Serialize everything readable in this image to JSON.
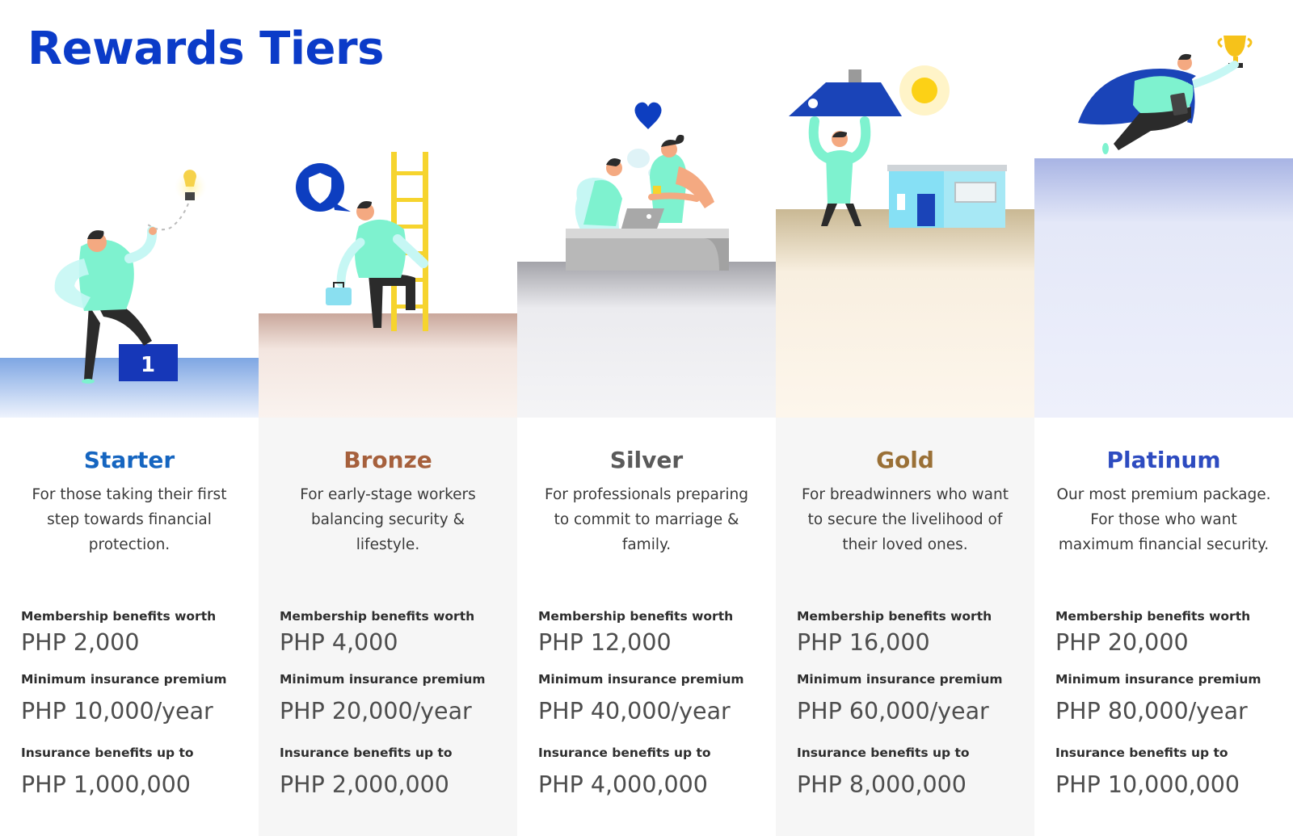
{
  "page": {
    "title": "Rewards Tiers"
  },
  "labels": {
    "membership": "Membership benefits worth",
    "premium": "Minimum insurance premium",
    "insurance": "Insurance benefits up to"
  },
  "step_badge": "1",
  "tiers": [
    {
      "name": "Starter",
      "color": "#1565c0",
      "description": "For those taking their first step towards financial protection.",
      "membership_value": "PHP 2,000",
      "premium_value": "PHP 10,000/year",
      "insurance_value": "PHP 1,000,000",
      "illustration": "person-stepping-with-lightbulb"
    },
    {
      "name": "Bronze",
      "color": "#a6603c",
      "description": "For early-stage workers balancing security & lifestyle.",
      "membership_value": "PHP 4,000",
      "premium_value": "PHP 20,000/year",
      "insurance_value": "PHP 2,000,000",
      "illustration": "person-climbing-ladder-with-shield"
    },
    {
      "name": "Silver",
      "color": "#5a5a5a",
      "description": "For professionals preparing to commit to marriage & family.",
      "membership_value": "PHP 12,000",
      "premium_value": "PHP 40,000/year",
      "insurance_value": "PHP 4,000,000",
      "illustration": "couple-with-heart"
    },
    {
      "name": "Gold",
      "color": "#9a7036",
      "description": "For breadwinners who want to secure the livelihood of their loved ones.",
      "membership_value": "PHP 16,000",
      "premium_value": "PHP 60,000/year",
      "insurance_value": "PHP 8,000,000",
      "illustration": "person-lifting-roof-with-house"
    },
    {
      "name": "Platinum",
      "color": "#2d4bc0",
      "description": "Our most premium package. For those who want maximum financial security.",
      "membership_value": "PHP 20,000",
      "premium_value": "PHP 80,000/year",
      "insurance_value": "PHP 10,000,000",
      "illustration": "flying-hero-with-trophy"
    }
  ]
}
